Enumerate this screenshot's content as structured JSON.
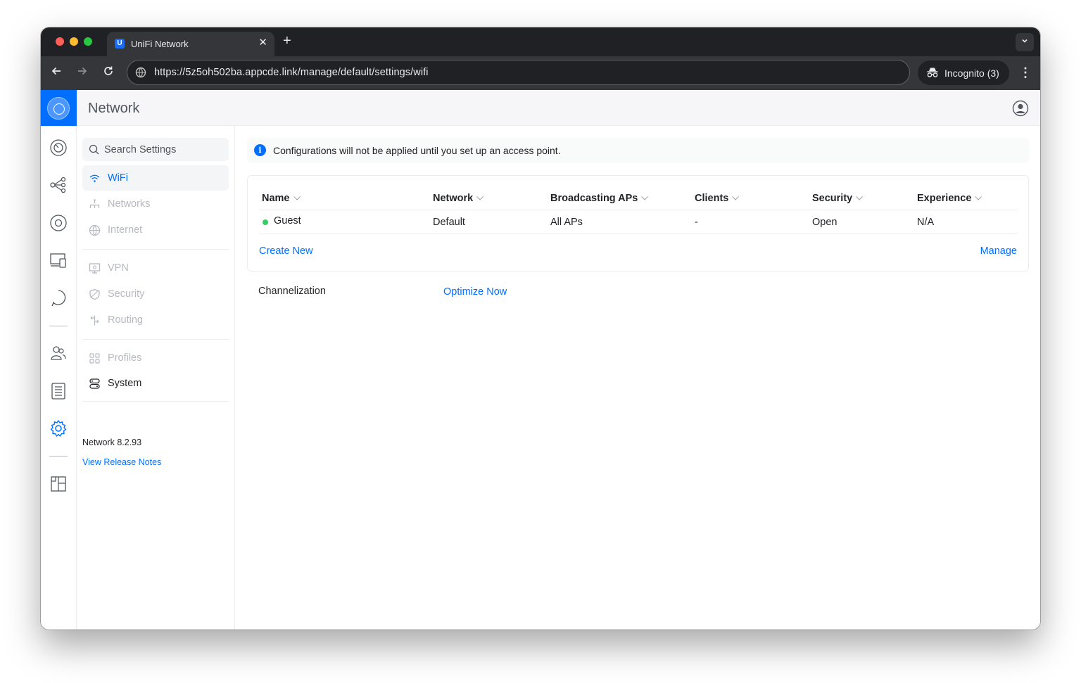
{
  "browser": {
    "tab_title": "UniFi Network",
    "tab_favicon_letter": "U",
    "tab_close": "✕",
    "new_tab": "+",
    "url": "https://5z5oh502ba.appcde.link/manage/default/settings/wifi",
    "incognito_label": "Incognito (3)",
    "menu_glyph": "⋮"
  },
  "header": {
    "app_title": "Network"
  },
  "sidebar": {
    "search_placeholder": "Search Settings",
    "items": [
      {
        "label": "WiFi",
        "state": "active"
      },
      {
        "label": "Networks",
        "state": "disabled"
      },
      {
        "label": "Internet",
        "state": "disabled"
      },
      {
        "label": "VPN",
        "state": "disabled"
      },
      {
        "label": "Security",
        "state": "disabled"
      },
      {
        "label": "Routing",
        "state": "disabled"
      },
      {
        "label": "Profiles",
        "state": "disabled"
      },
      {
        "label": "System",
        "state": "enabled"
      }
    ],
    "version": "Network 8.2.93",
    "release_notes_link": "View Release Notes"
  },
  "main": {
    "banner": "Configurations will not be applied until you set up an access point.",
    "table": {
      "columns": [
        "Name",
        "Network",
        "Broadcasting APs",
        "Clients",
        "Security",
        "Experience"
      ],
      "rows": [
        {
          "name": "Guest",
          "network": "Default",
          "aps": "All APs",
          "clients": "-",
          "security": "Open",
          "experience": "N/A",
          "status_color": "#38cc65"
        }
      ]
    },
    "create_new": "Create New",
    "manage": "Manage",
    "channelization_label": "Channelization",
    "optimize_now": "Optimize Now"
  },
  "colors": {
    "accent": "#006fff",
    "status_online": "#38cc65",
    "disabled_text": "#b6b9bf"
  }
}
